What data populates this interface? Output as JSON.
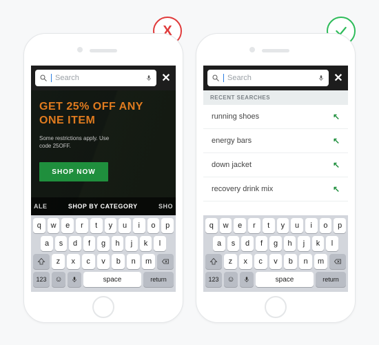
{
  "search": {
    "placeholder": "Search"
  },
  "left": {
    "promo_headline": "GET 25% OFF ANY ONE ITEM",
    "promo_sub": "Some restrictions apply. Use code 25OFF.",
    "shop_now": "SHOP NOW",
    "cat_left": "ALE",
    "cat_mid": "SHOP BY CATEGORY",
    "cat_right": "SHO"
  },
  "right": {
    "recent_header": "RECENT SEARCHES",
    "items": [
      {
        "label": "running shoes"
      },
      {
        "label": "energy bars"
      },
      {
        "label": "down jacket"
      },
      {
        "label": "recovery drink mix"
      }
    ]
  },
  "keyboard": {
    "row1": [
      "q",
      "w",
      "e",
      "r",
      "t",
      "y",
      "u",
      "i",
      "o",
      "p"
    ],
    "row2": [
      "a",
      "s",
      "d",
      "f",
      "g",
      "h",
      "j",
      "k",
      "l"
    ],
    "row3": [
      "z",
      "x",
      "c",
      "v",
      "b",
      "n",
      "m"
    ],
    "num": "123",
    "space": "space",
    "ret": "return"
  },
  "badges": {
    "bad": "X"
  }
}
